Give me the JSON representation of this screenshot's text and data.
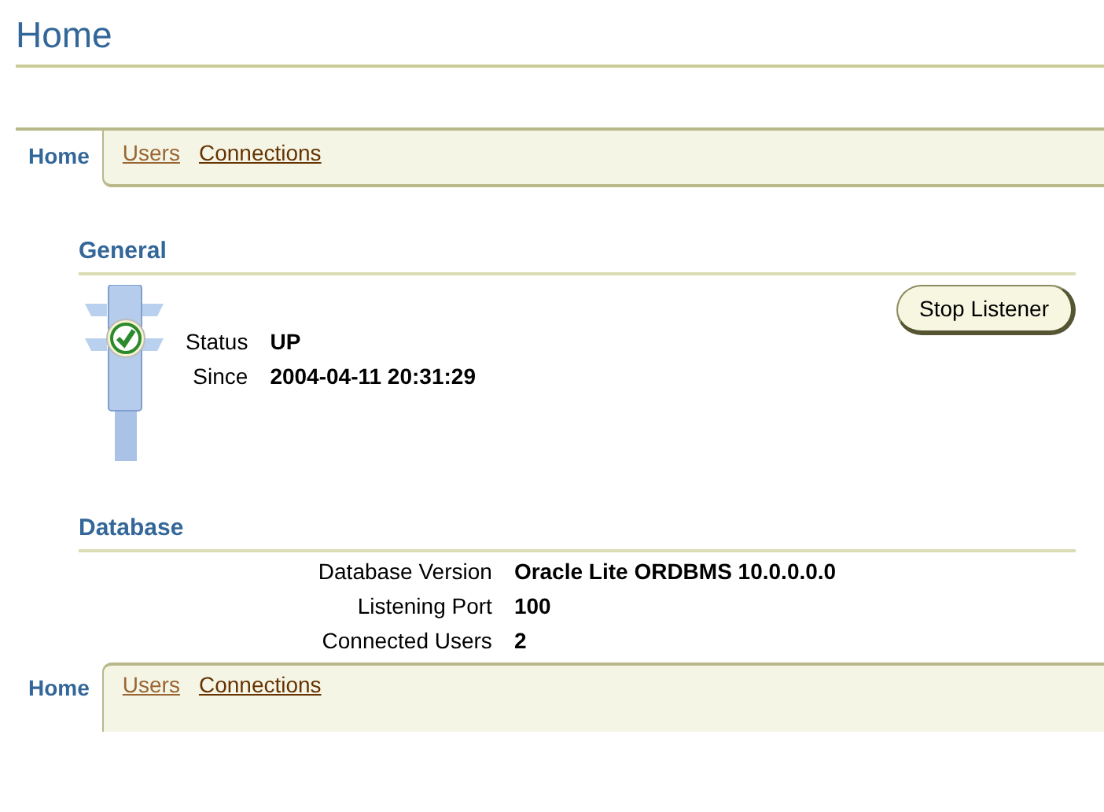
{
  "page_title": "Home",
  "tabs_top": [
    {
      "label": "Home",
      "selected": true
    },
    {
      "label": "Users",
      "selected": false,
      "visited": true
    },
    {
      "label": "Connections",
      "selected": false,
      "visited": false
    }
  ],
  "general": {
    "heading": "General",
    "status_up": true,
    "fields": [
      {
        "label": "Status",
        "value": "UP"
      },
      {
        "label": "Since",
        "value": "2004-04-11 20:31:29"
      }
    ],
    "button": "Stop Listener"
  },
  "database": {
    "heading": "Database",
    "fields": [
      {
        "label": "Database Version",
        "value": "Oracle Lite ORDBMS 10.0.0.0.0"
      },
      {
        "label": "Listening Port",
        "value": "100"
      },
      {
        "label": "Connected Users",
        "value": "2"
      }
    ]
  },
  "tabs_bottom": [
    {
      "label": "Home",
      "selected": true
    },
    {
      "label": "Users",
      "selected": false,
      "visited": true
    },
    {
      "label": "Connections",
      "selected": false,
      "visited": false
    }
  ]
}
